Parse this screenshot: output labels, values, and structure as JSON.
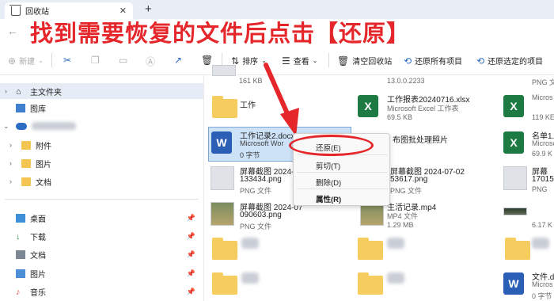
{
  "window": {
    "tab_title": "回收站",
    "new_tab": "+",
    "close_tab": "✕"
  },
  "overlay": {
    "instruction": "找到需要恢复的文件后点击【还原】"
  },
  "toolbar": {
    "new_label": "新建",
    "sort_label": "排序",
    "view_label": "查看",
    "empty_bin_label": "清空回收站",
    "restore_all_label": "还原所有项目",
    "restore_selected_label": "还原选定的项目"
  },
  "sidebar": {
    "home": "主文件夹",
    "gallery": "图库",
    "attachments": "附件",
    "pictures_cloud": "图片",
    "documents_cloud": "文档",
    "desktop": "桌面",
    "downloads": "下载",
    "documents": "文档",
    "pictures": "图片",
    "music": "音乐"
  },
  "files": {
    "top_left_size": "161 KB",
    "top_mid_version": "13.0.0.2233",
    "top_right_type": "PNG 文",
    "work_folder": "工作",
    "xlsx_name": "工作报表20240716.xlsx",
    "xlsx_type": "Microsoft Excel 工作表",
    "xlsx_size": "69.5 KB",
    "right_col_size1": "119 KE",
    "docx_name": "工作记录2.docx",
    "docx_type": "Microsoft Wor",
    "docx_size": "0 字节",
    "batch_photo": "布图批处理照片",
    "right_col_name2": "名单1.",
    "right_col_type2": "Microsc",
    "right_col_size2": "69.9 K",
    "shot1_name": "屏幕截图 2024-07",
    "shot1_name2": "133434.png",
    "shot1_type": "PNG 文件",
    "shot2_name": "屏幕截图 2024-07-02",
    "shot2_name2": "53617.png",
    "shot2_type": "PNG 文件",
    "right_col_name3": "屏幕",
    "right_col_name3b": "17015",
    "right_col_type3": "PNG",
    "shot3_name": "屏幕截图 2024-07",
    "shot3_name2": "090603.png",
    "shot3_type": "PNG 文件",
    "mp4_name": "生活记录.mp4",
    "mp4_type": "MP4 文件",
    "mp4_size": "1.29 MB",
    "right_col_size4": "6.17 K",
    "right_col_name5": "文件.d",
    "right_col_type5": "Micros",
    "right_col_size5": "0 字节"
  },
  "context_menu": {
    "restore": "还原(E)",
    "cut": "剪切(T)",
    "delete": "删除(D)",
    "properties": "属性(R)"
  },
  "colors": {
    "accent_red": "#e5262b",
    "selection_blue": "#cde2f7",
    "excel_green": "#1d7a43",
    "word_blue": "#2b5fb5",
    "folder_yellow": "#f6cc5e"
  }
}
